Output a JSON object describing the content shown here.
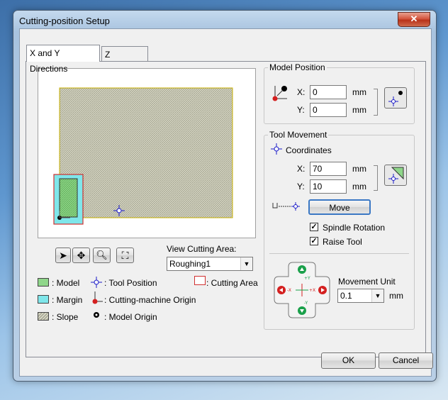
{
  "window": {
    "title": "Cutting-position Setup",
    "close_glyph": "✕"
  },
  "tabs": [
    {
      "label": "X and Y Directions"
    },
    {
      "label": "Z Direction"
    }
  ],
  "toolbar": {
    "select_icon": "arrow-pointer-icon",
    "pan_icon": "move-arrows-icon",
    "zoom_icon": "magnifier-icon",
    "fit_icon": "zoom-fit-icon"
  },
  "view_area": {
    "label": "View Cutting Area:",
    "label_underline": "A",
    "value": "Roughing1"
  },
  "legend": {
    "model": ": Model",
    "margin": ": Margin",
    "slope": ": Slope",
    "tool_position": ": Tool Position",
    "machine_origin": ": Cutting-machine Origin",
    "model_origin": ": Model Origin",
    "cutting_area": ": Cutting Area"
  },
  "model_position": {
    "title": "Model Position",
    "x_label": "X:",
    "x_value": "0",
    "x_unit": "mm",
    "y_label": "Y:",
    "y_value": "0",
    "y_unit": "mm"
  },
  "tool_movement": {
    "title": "Tool Movement",
    "coordinates_label": "Coordinates",
    "x_label": "X:",
    "x_value": "70",
    "x_unit": "mm",
    "y_label": "Y:",
    "y_value": "10",
    "y_unit": "mm",
    "move_button": "Move",
    "spindle_rotation": "Spindle Rotation",
    "spindle_checked": true,
    "raise_tool": "Raise Tool",
    "raise_checked": true,
    "movement_unit_label": "Movement Unit",
    "movement_unit_value": "0.1",
    "movement_unit_unit": "mm",
    "jog": {
      "up": "+Y",
      "down": "-Y",
      "left": "-X",
      "right": "+X"
    }
  },
  "footer": {
    "ok": "OK",
    "cancel": "Cancel"
  },
  "colors": {
    "model_fill": "#8fd68a",
    "margin_fill": "#7fe6ea",
    "slope_fill": "#c9c9b0",
    "cutting_area_border": "#d03030",
    "tool_marker": "#1a1ac8",
    "jog_arrow": "#1aa04a",
    "jog_arrow_x": "#d42020"
  }
}
